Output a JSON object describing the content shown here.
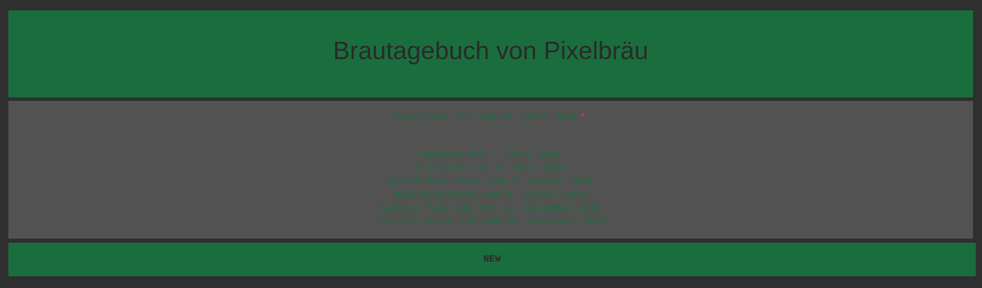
{
  "header": {
    "title": "Brautagebuch von Pixelbräu"
  },
  "current_brew": {
    "label": "Brazilian Ale vom 29. März 2021",
    "status_dot": "•",
    "status_color": "#e0302a"
  },
  "brews": [
    {
      "label": "testIPA vom 7. März 2021"
    },
    {
      "label": "Pixelpils vom 5. März 2021"
    },
    {
      "label": "Schrottbar Frank vom 3. Januar 2021"
    },
    {
      "label": "Neujahrsgebräu vom 1. Januar 2021"
    },
    {
      "label": "Galaxie Pale Ale vom 11. Dezember 2020"
    },
    {
      "label": "Pacific Coast IPA vom 16. November 2020"
    }
  ],
  "new_button": {
    "label": "NEW"
  },
  "colors": {
    "accent": "#1a6e3e",
    "panel": "#525252",
    "background": "#2f2f2f"
  }
}
